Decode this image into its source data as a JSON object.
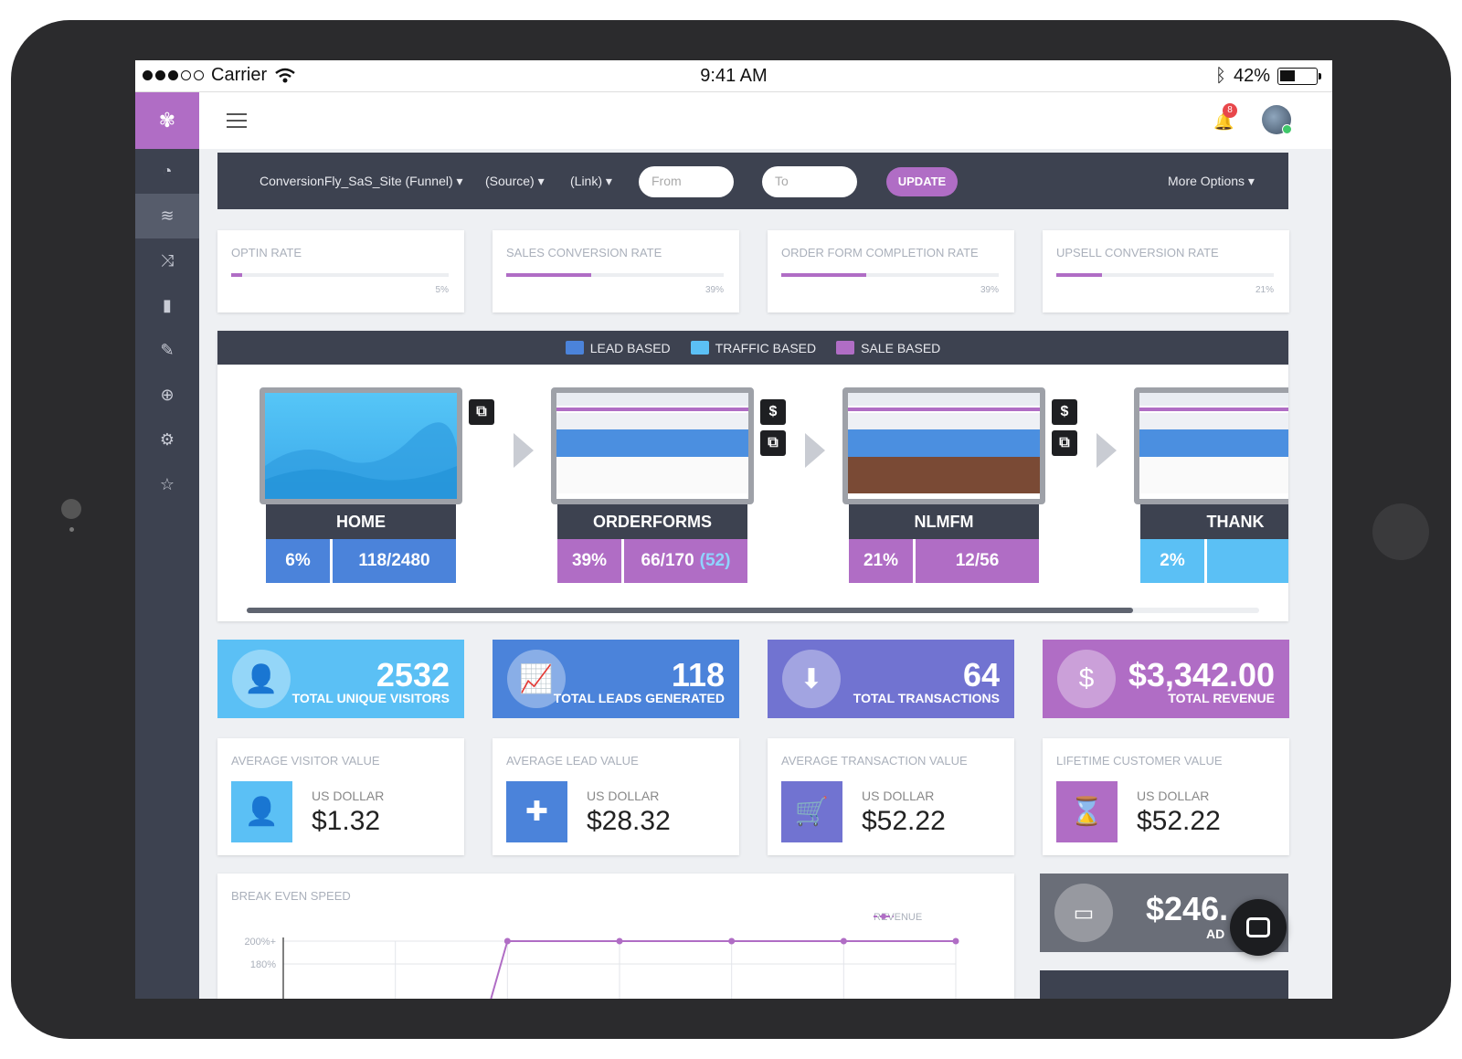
{
  "statusbar": {
    "carrier": "Carrier",
    "time": "9:41 AM",
    "battery": "42%",
    "battery_level": 0.42,
    "signal_bars": 3
  },
  "colors": {
    "purple": "#b06dc5",
    "dark": "#3d4250",
    "lead": "#4b83da",
    "traffic": "#5bc0f5",
    "sale": "#b06dc5",
    "transactions": "#7173d1"
  },
  "sidebar": {
    "logo_icon": "conversionfly-logo-icon",
    "items": [
      {
        "icon": "dashboard-icon",
        "glyph": "◔"
      },
      {
        "icon": "layers-icon",
        "glyph": "≋"
      },
      {
        "icon": "shuffle-icon",
        "glyph": "⤨"
      },
      {
        "icon": "bar-chart-icon",
        "glyph": "▮"
      },
      {
        "icon": "edit-icon",
        "glyph": "✎"
      },
      {
        "icon": "crosshair-icon",
        "glyph": "⊕"
      },
      {
        "icon": "gear-icon",
        "glyph": "⚙"
      },
      {
        "icon": "star-icon",
        "glyph": "☆"
      }
    ]
  },
  "header": {
    "notification_count": "8"
  },
  "filters": {
    "funnel": "ConversionFly_SaS_Site (Funnel)",
    "source": "(Source)",
    "link": "(Link)",
    "from_placeholder": "From",
    "to_placeholder": "To",
    "update_label": "UPDATE",
    "more_options": "More Options"
  },
  "rates": [
    {
      "title": "OPTIN RATE",
      "value": "5%",
      "fraction": 0.05
    },
    {
      "title": "SALES CONVERSION RATE",
      "value": "39%",
      "fraction": 0.39
    },
    {
      "title": "ORDER FORM COMPLETION RATE",
      "value": "39%",
      "fraction": 0.39
    },
    {
      "title": "UPSELL CONVERSION RATE",
      "value": "21%",
      "fraction": 0.21
    }
  ],
  "legend": [
    {
      "label": "LEAD BASED",
      "color": "#4b83da"
    },
    {
      "label": "TRAFFIC BASED",
      "color": "#5bc0f5"
    },
    {
      "label": "SALE BASED",
      "color": "#b06dc5"
    }
  ],
  "stages": [
    {
      "name": "HOME",
      "pct": "6%",
      "count": "118/2480",
      "extra": "",
      "color": "#4b83da",
      "icons": [
        "copy"
      ]
    },
    {
      "name": "ORDERFORMS",
      "pct": "39%",
      "count": "66/170",
      "extra": "(52)",
      "color": "#b06dc5",
      "icons": [
        "dollar",
        "copy"
      ]
    },
    {
      "name": "NLMFM",
      "pct": "21%",
      "count": "12/56",
      "extra": "",
      "color": "#b06dc5",
      "icons": [
        "dollar",
        "copy"
      ]
    },
    {
      "name": "THANK",
      "pct": "2%",
      "count": "",
      "extra": "",
      "color": "#5bc0f5",
      "icons": []
    }
  ],
  "scroll_position": 0.875,
  "stats": [
    {
      "num": "2532",
      "label": "TOTAL UNIQUE VISITORS",
      "color": "#5bc0f5",
      "icon": "user-icon",
      "glyph": "👤"
    },
    {
      "num": "118",
      "label": "TOTAL LEADS GENERATED",
      "color": "#4b83da",
      "icon": "growth-chart-icon",
      "glyph": "📈"
    },
    {
      "num": "64",
      "label": "TOTAL TRANSACTIONS",
      "color": "#7173d1",
      "icon": "cart-download-icon",
      "glyph": "⬇"
    },
    {
      "num": "$3,342.00",
      "label": "TOTAL REVENUE",
      "color": "#b06dc5",
      "icon": "dollar-icon",
      "glyph": "$"
    }
  ],
  "values": [
    {
      "title": "AVERAGE VISITOR VALUE",
      "unit": "US DOLLAR",
      "value": "$1.32",
      "color": "#5bc0f5",
      "icon": "user-icon",
      "glyph": "👤"
    },
    {
      "title": "AVERAGE LEAD VALUE",
      "unit": "US DOLLAR",
      "value": "$28.32",
      "color": "#4b83da",
      "icon": "add-user-icon",
      "glyph": "✚"
    },
    {
      "title": "AVERAGE TRANSACTION VALUE",
      "unit": "US DOLLAR",
      "value": "$52.22",
      "color": "#7173d1",
      "icon": "cart-icon",
      "glyph": "🛒"
    },
    {
      "title": "LIFETIME CUSTOMER VALUE",
      "unit": "US DOLLAR",
      "value": "$52.22",
      "color": "#b06dc5",
      "icon": "hourglass-icon",
      "glyph": "⌛"
    }
  ],
  "break_even": {
    "title": "BREAK EVEN SPEED",
    "chart_data": {
      "type": "line",
      "title": "",
      "xlabel": "",
      "ylabel": "",
      "y_ticks": [
        "200%+",
        "180%"
      ],
      "series": [
        {
          "name": "REVENUE",
          "values": [
            "",
            "",
            "200%+",
            "200%+",
            "200%+",
            "200%+",
            "200%+"
          ]
        }
      ],
      "grid": true,
      "legend_position": "top-right"
    }
  },
  "ad_card": {
    "num": "$246.",
    "label": "AD",
    "icon": "wallet-icon"
  }
}
